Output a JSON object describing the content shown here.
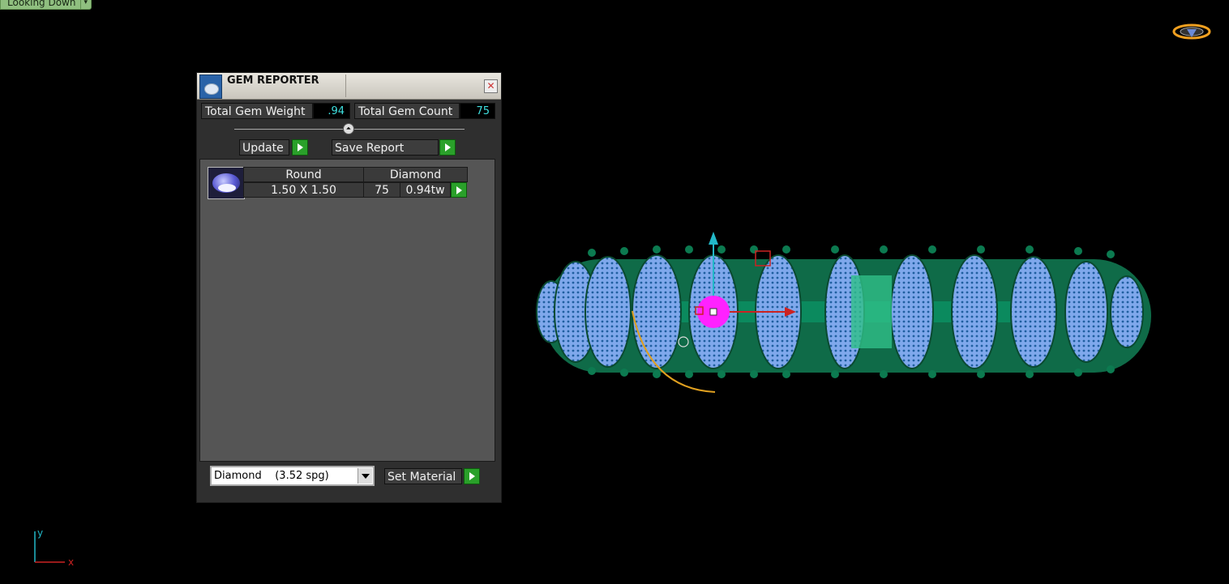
{
  "viewport": {
    "view_label": "Looking Down",
    "view_dropdown_glyph": "▾",
    "logo_icon": "gem-logo-icon",
    "axis_y": "y",
    "axis_x": "x"
  },
  "panel": {
    "title": "GEM REPORTER",
    "close_glyph": "✕",
    "total_weight_label": "Total Gem Weight",
    "total_weight_value": ".94",
    "total_count_label": "Total Gem Count",
    "total_count_value": "75",
    "slider_glyph": "⏶",
    "update_label": "Update",
    "save_report_label": "Save Report",
    "gems": [
      {
        "shape": "Round",
        "material": "Diamond",
        "size": "1.50 X 1.50",
        "count": "75",
        "weight": "0.94tw"
      }
    ],
    "material_select": "Diamond    (3.52 spg)",
    "set_material_label": "Set Material"
  },
  "colors": {
    "accent_green": "#2aa02a",
    "value_cyan": "#3fe0e0",
    "ring_green": "#0f6b48",
    "gem_blue": "#8fb8f0",
    "gizmo_magenta": "#ff22ff"
  }
}
